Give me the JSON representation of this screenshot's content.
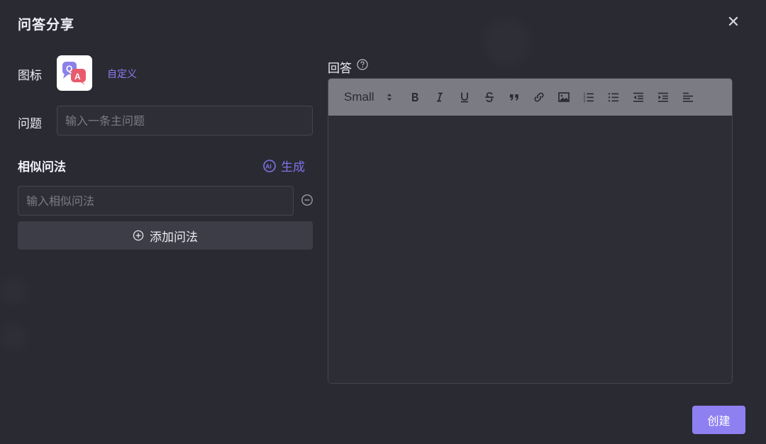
{
  "dialog": {
    "title": "问答分享",
    "close_glyph": "✕"
  },
  "form": {
    "icon_label": "图标",
    "icon_image_text": "Q A",
    "customize_link": "自定义",
    "question_label": "问题",
    "question_placeholder": "输入一条主问题",
    "question_value": "",
    "similar_title": "相似问法",
    "generate_label": "生成",
    "similar_placeholder": "输入相似问法",
    "similar_value": "",
    "add_label": "添加问法"
  },
  "answer": {
    "label": "回答",
    "font_size_option": "Small",
    "toolbar_icons": [
      "bold-icon",
      "italic-icon",
      "underline-icon",
      "strikethrough-icon",
      "blockquote-icon",
      "link-icon",
      "image-icon",
      "ordered-list-icon",
      "bullet-list-icon",
      "outdent-icon",
      "indent-icon",
      "align-left-icon"
    ]
  },
  "footer": {
    "create_label": "创建"
  },
  "colors": {
    "accent": "#8f80f2",
    "link": "#8a7cf0",
    "background": "#2a2a33",
    "toolbar": "#7b7b84"
  }
}
